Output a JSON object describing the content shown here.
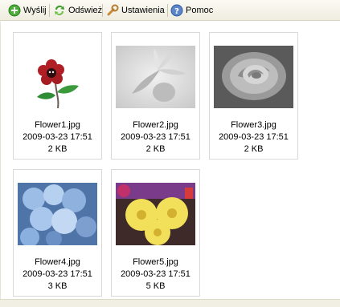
{
  "toolbar": {
    "items": [
      {
        "label": "Wyślij",
        "icon": "send-icon"
      },
      {
        "label": "Odśwież",
        "icon": "refresh-icon"
      },
      {
        "label": "Ustawienia",
        "icon": "wrench-icon"
      },
      {
        "label": "Pomoc",
        "icon": "help-icon"
      }
    ]
  },
  "files": [
    {
      "name": "Flower1.jpg",
      "date": "2009-03-23 17:51",
      "size": "2 KB"
    },
    {
      "name": "Flower2.jpg",
      "date": "2009-03-23 17:51",
      "size": "2 KB"
    },
    {
      "name": "Flower3.jpg",
      "date": "2009-03-23 17:51",
      "size": "2 KB"
    },
    {
      "name": "Flower4.jpg",
      "date": "2009-03-23 17:51",
      "size": "3 KB"
    },
    {
      "name": "Flower5.jpg",
      "date": "2009-03-23 17:51",
      "size": "5 KB"
    }
  ],
  "colors": {
    "toolbar_bg": "#efede0",
    "card_border": "#d9d9d9"
  }
}
